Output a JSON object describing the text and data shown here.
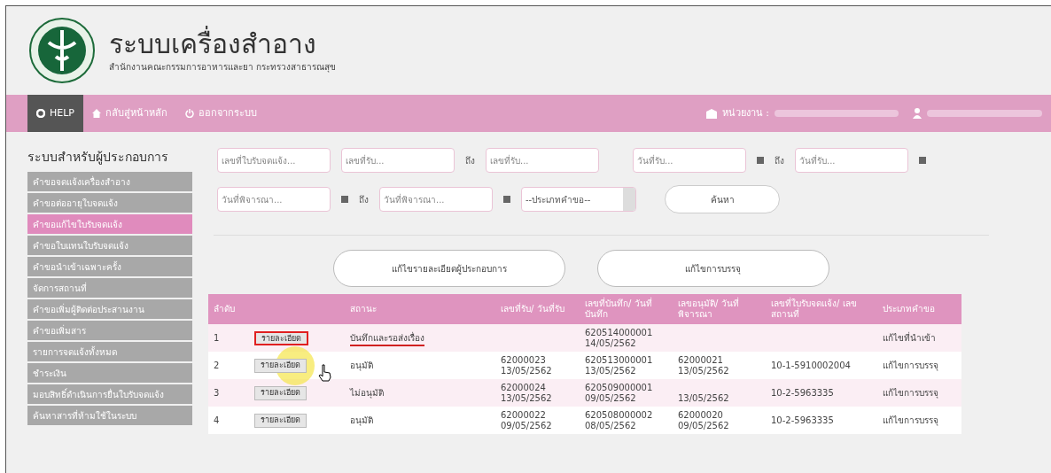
{
  "header": {
    "title": "ระบบเครื่องสำอาง",
    "subtitle": "สำนักงานคณะกรรมการอาหารและยา กระทรวงสาธารณสุข"
  },
  "nav": {
    "items": [
      {
        "label": "HELP",
        "selected": true
      },
      {
        "label": "กลับสู่หน้าหลัก",
        "selected": false
      },
      {
        "label": "ออกจากระบบ",
        "selected": false
      }
    ],
    "agency_label": "หน่วยงาน :"
  },
  "sidebar": {
    "title": "ระบบสำหรับผู้ประกอบการ",
    "items": [
      {
        "label": "คำขอจดแจ้งเครื่องสำอาง",
        "selected": false
      },
      {
        "label": "คำขอต่ออายุใบจดแจ้ง",
        "selected": false
      },
      {
        "label": "คำขอแก้ไขใบรับจดแจ้ง",
        "selected": true
      },
      {
        "label": "คำขอใบแทนใบรับจดแจ้ง",
        "selected": false
      },
      {
        "label": "คำขอนำเข้าเฉพาะครั้ง",
        "selected": false
      },
      {
        "label": "จัดการสถานที่",
        "selected": false
      },
      {
        "label": "คำขอเพิ่มผู้ติดต่อประสานงาน",
        "selected": false
      },
      {
        "label": "คำขอเพิ่มสาร",
        "selected": false
      },
      {
        "label": "รายการจดแจ้งทั้งหมด",
        "selected": false
      },
      {
        "label": "ชำระเงิน",
        "selected": false
      },
      {
        "label": "มอบสิทธิ์ดำเนินการยื่นใบรับจดแจ้ง",
        "selected": false
      },
      {
        "label": "ค้นหาสารที่ห้ามใช้ในระบบ",
        "selected": false
      }
    ]
  },
  "filters": {
    "first_row": [
      {
        "kind": "field",
        "placeholder": "เลขที่ใบรับจดแจ้ง..."
      },
      {
        "kind": "field",
        "placeholder": "เลขที่รับ..."
      },
      {
        "kind": "text",
        "label": "ถึง"
      },
      {
        "kind": "field",
        "placeholder": "เลขที่รับ..."
      },
      {
        "kind": "gap"
      },
      {
        "kind": "field",
        "placeholder": "วันที่รับ..."
      },
      {
        "kind": "calendar"
      },
      {
        "kind": "text",
        "label": "ถึง"
      },
      {
        "kind": "field",
        "placeholder": "วันที่รับ..."
      },
      {
        "kind": "calendar"
      }
    ],
    "second_row": [
      {
        "kind": "field",
        "placeholder": "วันที่พิจารณา..."
      },
      {
        "kind": "calendar"
      },
      {
        "kind": "text",
        "label": "ถึง"
      },
      {
        "kind": "field",
        "placeholder": "วันที่พิจารณา..."
      },
      {
        "kind": "calendar"
      },
      {
        "kind": "select",
        "value": "--ประเภทคำขอ--"
      },
      {
        "kind": "button",
        "label": "ค้นหา"
      }
    ]
  },
  "actions": [
    "แก้ไขรายละเอียดผู้ประกอบการ",
    "แก้ไขการบรรจุ"
  ],
  "table": {
    "columns": [
      "ลำดับ",
      "",
      "สถานะ",
      "เลขที่รับ/ วันที่รับ",
      "เลขที่บันทึก/ วันที่บันทึก",
      "เลขอนุมัติ/ วันที่พิจารณา",
      "เลขที่ใบรับจดแจ้ง/ เลขสถานที่",
      "ประเภทคำขอ"
    ],
    "rows": [
      {
        "no": "1",
        "button": "รายละเอียด",
        "status": "บันทึกและรอส่งเรื่อง",
        "status_underlined": true,
        "highlighted": true,
        "pointer": false,
        "saved": {
          "number": "620514000001",
          "date": "14/05/2562"
        },
        "type": "แก้ไขที่นำเข้า"
      },
      {
        "no": "2",
        "button": "รายละเอียด",
        "status": "อนุมัติ",
        "status_underlined": false,
        "highlighted": false,
        "pointer": true,
        "received": {
          "number": "62000023",
          "date": "13/05/2562"
        },
        "saved": {
          "number": "620513000001",
          "date": "13/05/2562"
        },
        "approval": {
          "number": "62000021",
          "date": "13/05/2562"
        },
        "license": "10-1-5910002004",
        "type": "แก้ไขการบรรจุ"
      },
      {
        "no": "3",
        "button": "รายละเอียด",
        "status": "ไม่อนุมัติ",
        "status_underlined": false,
        "highlighted": false,
        "pointer": false,
        "received": {
          "number": "62000024",
          "date": "13/05/2562"
        },
        "saved": {
          "number": "620509000001",
          "date": "09/05/2562"
        },
        "approval": {
          "date": "13/05/2562"
        },
        "license": "10-2-5963335",
        "type": "แก้ไขการบรรจุ"
      },
      {
        "no": "4",
        "button": "รายละเอียด",
        "status": "อนุมัติ",
        "status_underlined": false,
        "highlighted": false,
        "pointer": false,
        "received": {
          "number": "62000022",
          "date": "09/05/2562"
        },
        "saved": {
          "number": "620508000002",
          "date": "08/05/2562"
        },
        "approval": {
          "number": "62000020",
          "date": "09/05/2562"
        },
        "license": "10-2-5963335",
        "type": "แก้ไขการบรรจุ"
      }
    ]
  }
}
